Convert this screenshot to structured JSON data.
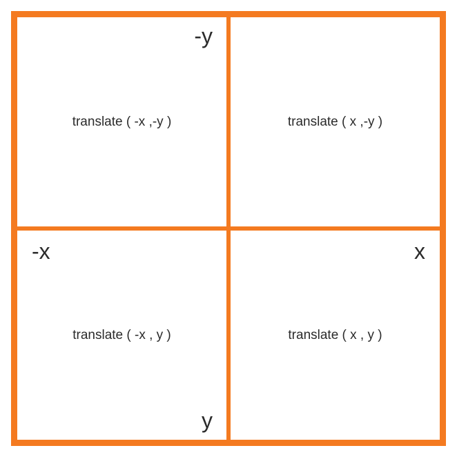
{
  "quadrants": {
    "top_left": "translate ( -x ,-y )",
    "top_right": "translate ( x ,-y )",
    "bottom_left": "translate ( -x , y )",
    "bottom_right": "translate ( x , y )"
  },
  "axes": {
    "neg_y": "-y",
    "neg_x": "-x",
    "x": "x",
    "y": "y"
  },
  "colors": {
    "border": "#f47a20",
    "text": "#2b2b2b"
  }
}
